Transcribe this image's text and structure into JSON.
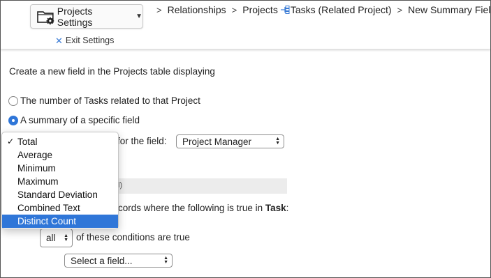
{
  "header": {
    "settings_label": "Projects Settings",
    "exit_label": "Exit Settings",
    "breadcrumb": [
      "Relationships",
      "Projects",
      "Tasks (Related Project)",
      "New Summary Field"
    ]
  },
  "main": {
    "intro": "Create a new field in the Projects table displaying",
    "option_count_label": "The number of Tasks related to that Project",
    "option_summary_label": "A summary of a specific field",
    "field_label": "for the field:",
    "field_value": "Project Manager",
    "band_text": "l)",
    "records_prefix": "cords where the following is true in ",
    "records_table": "Task",
    "records_suffix": ":",
    "match_value": "all",
    "conditions_text": "of these conditions are true",
    "select_field_placeholder": "Select a field..."
  },
  "menu": {
    "items": [
      {
        "label": "Total",
        "checked": true
      },
      {
        "label": "Average"
      },
      {
        "label": "Minimum"
      },
      {
        "label": "Maximum"
      },
      {
        "label": "Standard Deviation"
      },
      {
        "label": "Combined Text"
      },
      {
        "label": "Distinct Count",
        "highlighted": true
      }
    ]
  },
  "colors": {
    "accent": "#2f76d8",
    "exit_x": "#3a7bd5"
  }
}
